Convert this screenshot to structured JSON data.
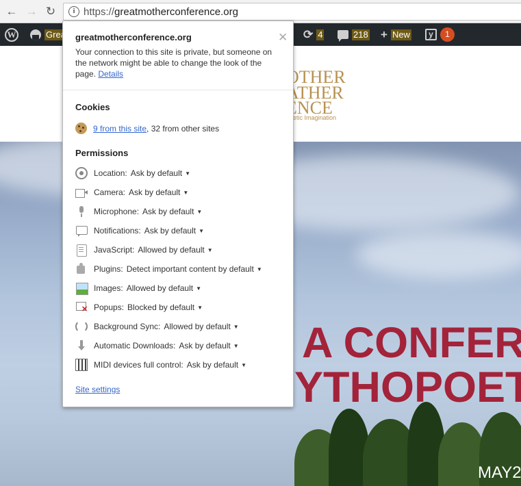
{
  "browser": {
    "url_scheme": "https://",
    "url_host": "greatmotherconference.org"
  },
  "adminbar": {
    "site_label": "Grea",
    "updates_count": "4",
    "comments_count": "218",
    "new_label": "New",
    "notifications_count": "1"
  },
  "site": {
    "logo_line1": "OTHER",
    "logo_line2": "ATHER",
    "logo_line3": "ENCE",
    "logo_tagline": "poetic Imagination"
  },
  "hero": {
    "line1": "A CONFER",
    "line2": "YTHOPOET",
    "date_partial": "MAY2"
  },
  "popup": {
    "site_name": "greatmotherconference.org",
    "description": "Your connection to this site is private, but someone on the network might be able to change the look of the page.",
    "details_link": "Details",
    "cookies_heading": "Cookies",
    "cookies_link": "9 from this site",
    "cookies_rest": ", 32 from other sites",
    "permissions_heading": "Permissions",
    "permissions": [
      {
        "label": "Location:",
        "value": "Ask by default",
        "icon": "location-icon"
      },
      {
        "label": "Camera:",
        "value": "Ask by default",
        "icon": "camera-icon"
      },
      {
        "label": "Microphone:",
        "value": "Ask by default",
        "icon": "microphone-icon"
      },
      {
        "label": "Notifications:",
        "value": "Ask by default",
        "icon": "notifications-icon"
      },
      {
        "label": "JavaScript:",
        "value": "Allowed by default",
        "icon": "javascript-icon"
      },
      {
        "label": "Plugins:",
        "value": "Detect important content by default",
        "icon": "plugins-icon"
      },
      {
        "label": "Images:",
        "value": "Allowed by default",
        "icon": "images-icon"
      },
      {
        "label": "Popups:",
        "value": "Blocked by default",
        "icon": "popups-blocked-icon"
      },
      {
        "label": "Background Sync:",
        "value": "Allowed by default",
        "icon": "background-sync-icon"
      },
      {
        "label": "Automatic Downloads:",
        "value": "Ask by default",
        "icon": "automatic-downloads-icon"
      },
      {
        "label": "MIDI devices full control:",
        "value": "Ask by default",
        "icon": "midi-icon"
      }
    ],
    "site_settings_link": "Site settings"
  }
}
